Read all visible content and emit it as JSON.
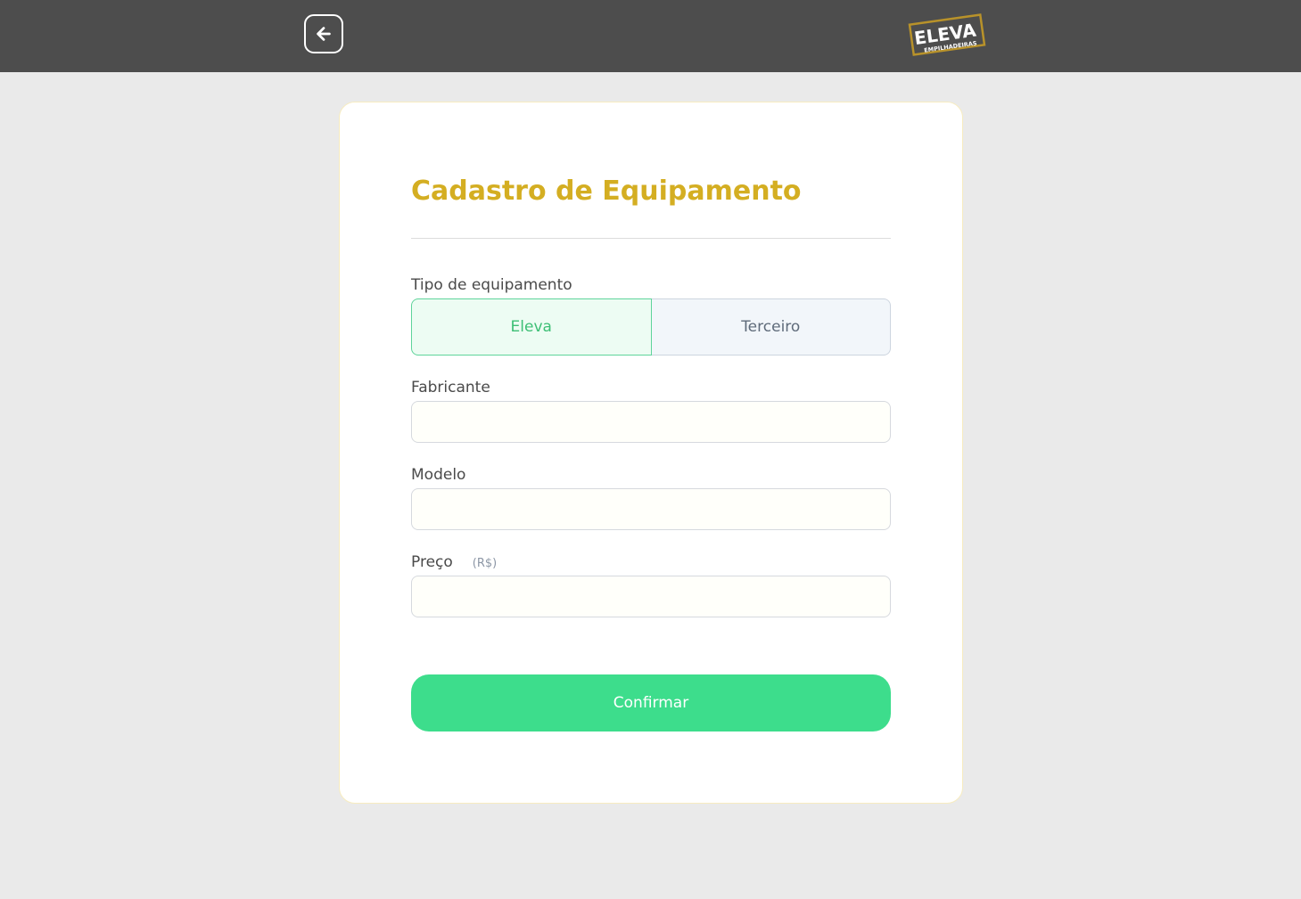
{
  "header": {
    "back_icon": "arrow-left-icon",
    "logo": {
      "text": "ELEVA",
      "subtext": "EMPILHADEIRAS",
      "color": "#b8922a"
    }
  },
  "form": {
    "title": "Cadastro de Equipamento",
    "type": {
      "label": "Tipo de equipamento",
      "options": [
        "Eleva",
        "Terceiro"
      ],
      "selected": "Eleva"
    },
    "fabricante": {
      "label": "Fabricante",
      "value": "",
      "placeholder": ""
    },
    "modelo": {
      "label": "Modelo",
      "value": "",
      "placeholder": ""
    },
    "preco": {
      "label": "Preço",
      "unit": "(R$)",
      "value": "",
      "placeholder": ""
    },
    "confirm_label": "Confirmar"
  },
  "colors": {
    "header_bg": "#4d4d4d",
    "page_bg": "#eaeaea",
    "title": "#d4ae22",
    "accent_green": "#3ddd8c",
    "selected_text": "#3dbf75"
  }
}
